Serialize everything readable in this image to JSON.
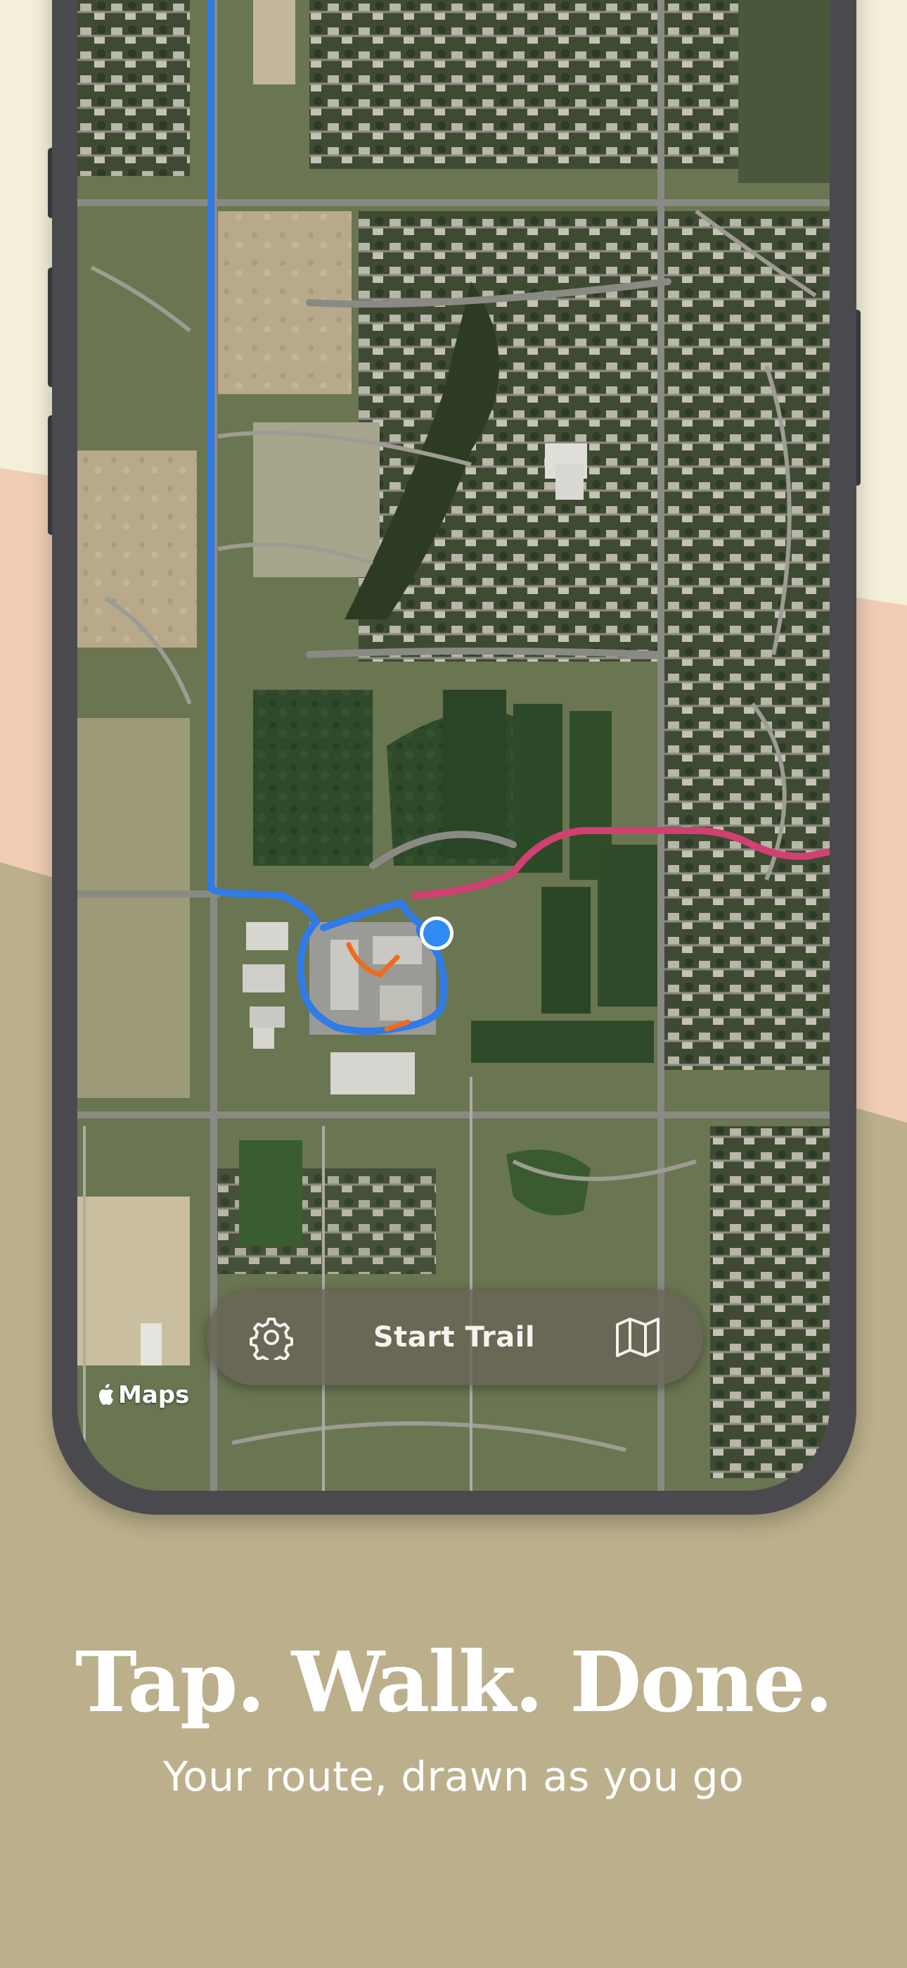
{
  "toolbar": {
    "start_label": "Start Trail",
    "settings_icon": "gear-icon",
    "map_icon": "map-icon"
  },
  "map": {
    "attribution": "Maps",
    "attribution_icon": "apple-logo-icon",
    "route_colors": {
      "primary": "#2f7be8",
      "secondary": "#d23f73",
      "accent": "#ee6b1e"
    }
  },
  "marketing": {
    "headline": "Tap. Walk. Done.",
    "subheadline": "Your route, drawn as you go"
  },
  "colors": {
    "bg_cream": "#f4efd9",
    "bg_peach": "#f0cdb4",
    "bg_olive": "#bbb08b",
    "phone_frame": "#4a4a4e"
  }
}
